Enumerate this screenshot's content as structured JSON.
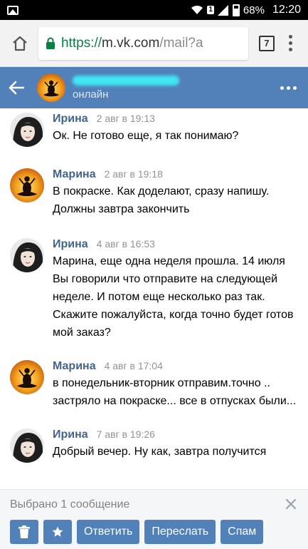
{
  "status_bar": {
    "sim": "1",
    "battery_percent": "68%",
    "time": "12:20"
  },
  "browser": {
    "url_scheme": "https://",
    "url_host": "m.vk.com",
    "url_path": "/mail?a",
    "tab_count": "7"
  },
  "header": {
    "status": "онлайн"
  },
  "messages": [
    {
      "author": "Ирина",
      "time": "2 авг в 19:13",
      "text": "Ок. Не готово еще, я так понимаю?",
      "avatar": "irina"
    },
    {
      "author": "Марина",
      "time": "2 авг в 19:18",
      "text": "В покраске. Как доделают, сразу напишу. Должны завтра закончить",
      "avatar": "marina"
    },
    {
      "author": "Ирина",
      "time": "4 авг в 16:53",
      "text": "Марина, еще одна неделя прошла. 14 июля Вы говорили что отправите на следующей неделе. И потом еще несколько раз так. Скажите пожалуйста, когда точно будет готов мой заказ?",
      "avatar": "irina"
    },
    {
      "author": "Марина",
      "time": "4 авг в 17:04",
      "text": "в понедельник-вторник отправим.точно .. застряло на покраске... все в отпусках были...",
      "avatar": "marina"
    },
    {
      "author": "Ирина",
      "time": "7 авг в 19:26",
      "text": "Добрый вечер. Ну как, завтра получится",
      "avatar": "irina"
    }
  ],
  "selection": {
    "title": "Выбрано 1 сообщение",
    "reply_label": "Ответить",
    "forward_label": "Переслать",
    "spam_label": "Спам"
  },
  "colors": {
    "vk_blue": "#5181b8",
    "author_blue": "#42648b"
  }
}
